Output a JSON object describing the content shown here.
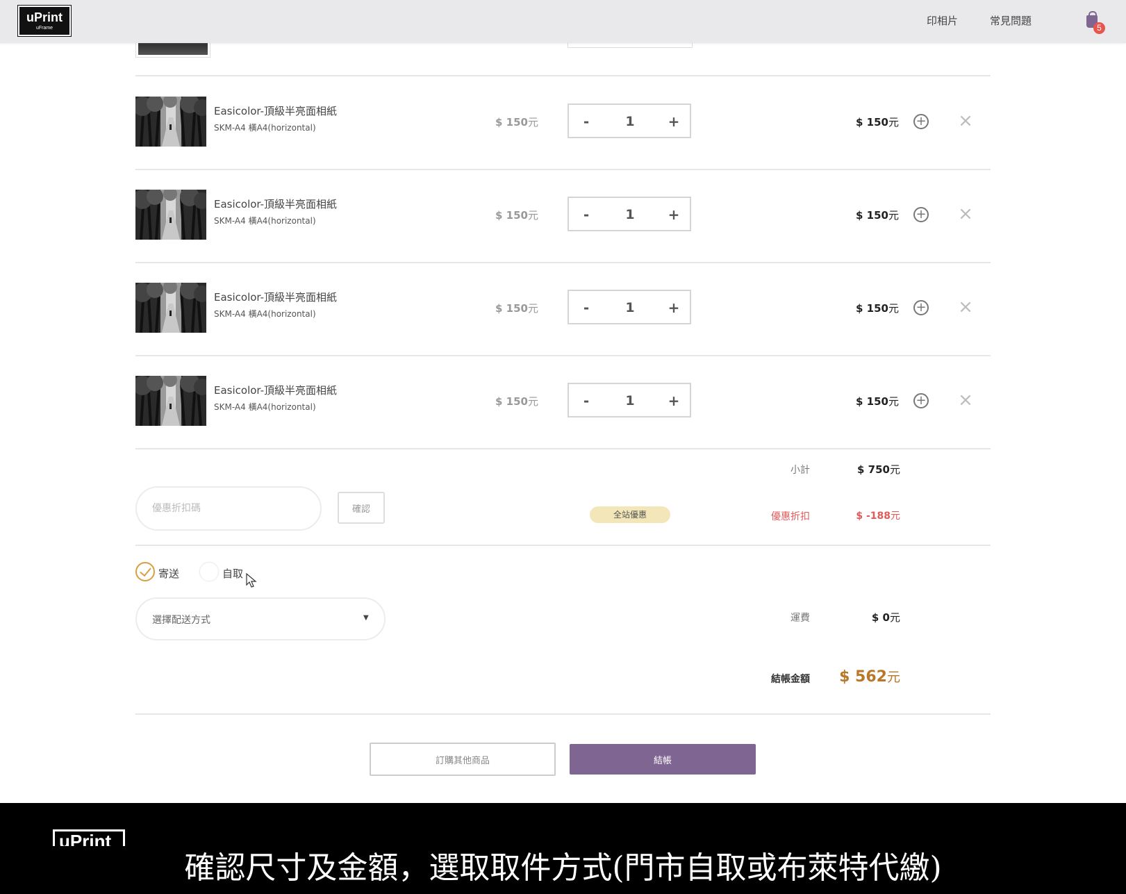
{
  "header": {
    "logo_text": "uPrint",
    "logo_sub": "uFrame",
    "nav": [
      "印相片",
      "常見問題"
    ],
    "cart_count": "5",
    "colors": {
      "bar": "#e9e9ec",
      "brand": "#7e6690",
      "badge": "#e8554e"
    }
  },
  "items": [
    {
      "name": "Easicolor-頂級半亮面相紙",
      "sub": "SKM-A4  橫A4(horizontal)",
      "unit_price": "$ 150",
      "currency": "元",
      "qty_minus": "-",
      "qty": "1",
      "qty_plus": "+",
      "line_total": "$ 150",
      "add_icon": "+",
      "remove_icon": "×"
    },
    {
      "name": "Easicolor-頂級半亮面相紙",
      "sub": "SKM-A4  橫A4(horizontal)",
      "unit_price": "$ 150",
      "currency": "元",
      "qty_minus": "-",
      "qty": "1",
      "qty_plus": "+",
      "line_total": "$ 150",
      "add_icon": "+",
      "remove_icon": "×"
    },
    {
      "name": "Easicolor-頂級半亮面相紙",
      "sub": "SKM-A4  橫A4(horizontal)",
      "unit_price": "$ 150",
      "currency": "元",
      "qty_minus": "-",
      "qty": "1",
      "qty_plus": "+",
      "line_total": "$ 150",
      "add_icon": "+",
      "remove_icon": "×"
    },
    {
      "name": "Easicolor-頂級半亮面相紙",
      "sub": "SKM-A4  橫A4(horizontal)",
      "unit_price": "$ 150",
      "currency": "元",
      "qty_minus": "-",
      "qty": "1",
      "qty_plus": "+",
      "line_total": "$ 150",
      "add_icon": "+",
      "remove_icon": "×"
    }
  ],
  "summary": {
    "subtotal_label": "小計",
    "subtotal_value": "$ 750",
    "coupon_placeholder": "優惠折扣碼",
    "coupon_confirm": "確認",
    "promo_badge": "全站優惠",
    "discount_label": "優惠折扣",
    "discount_value": "$ -188",
    "delivery_options": [
      "寄送",
      "自取"
    ],
    "delivery_selected": "寄送",
    "shipping_select_text": "選擇配送方式",
    "shipping_select_arrow": "▼",
    "shipping_label": "運費",
    "shipping_value": "$ 0",
    "total_label": "結帳金額",
    "total_value": "$ 562",
    "currency": "元",
    "colors": {
      "discount": "#e05a5a",
      "total": "#b9772a",
      "promo": "#f3e7b9",
      "check": "#d8a03c"
    }
  },
  "buttons": {
    "continue_shopping": "訂購其他商品",
    "checkout": "結帳",
    "checkout_color": "#7f6692"
  },
  "caption": {
    "logo_text": "uPrint",
    "text": "確認尺寸及金額，選取取件方式(門市自取或布萊特代繳)"
  }
}
